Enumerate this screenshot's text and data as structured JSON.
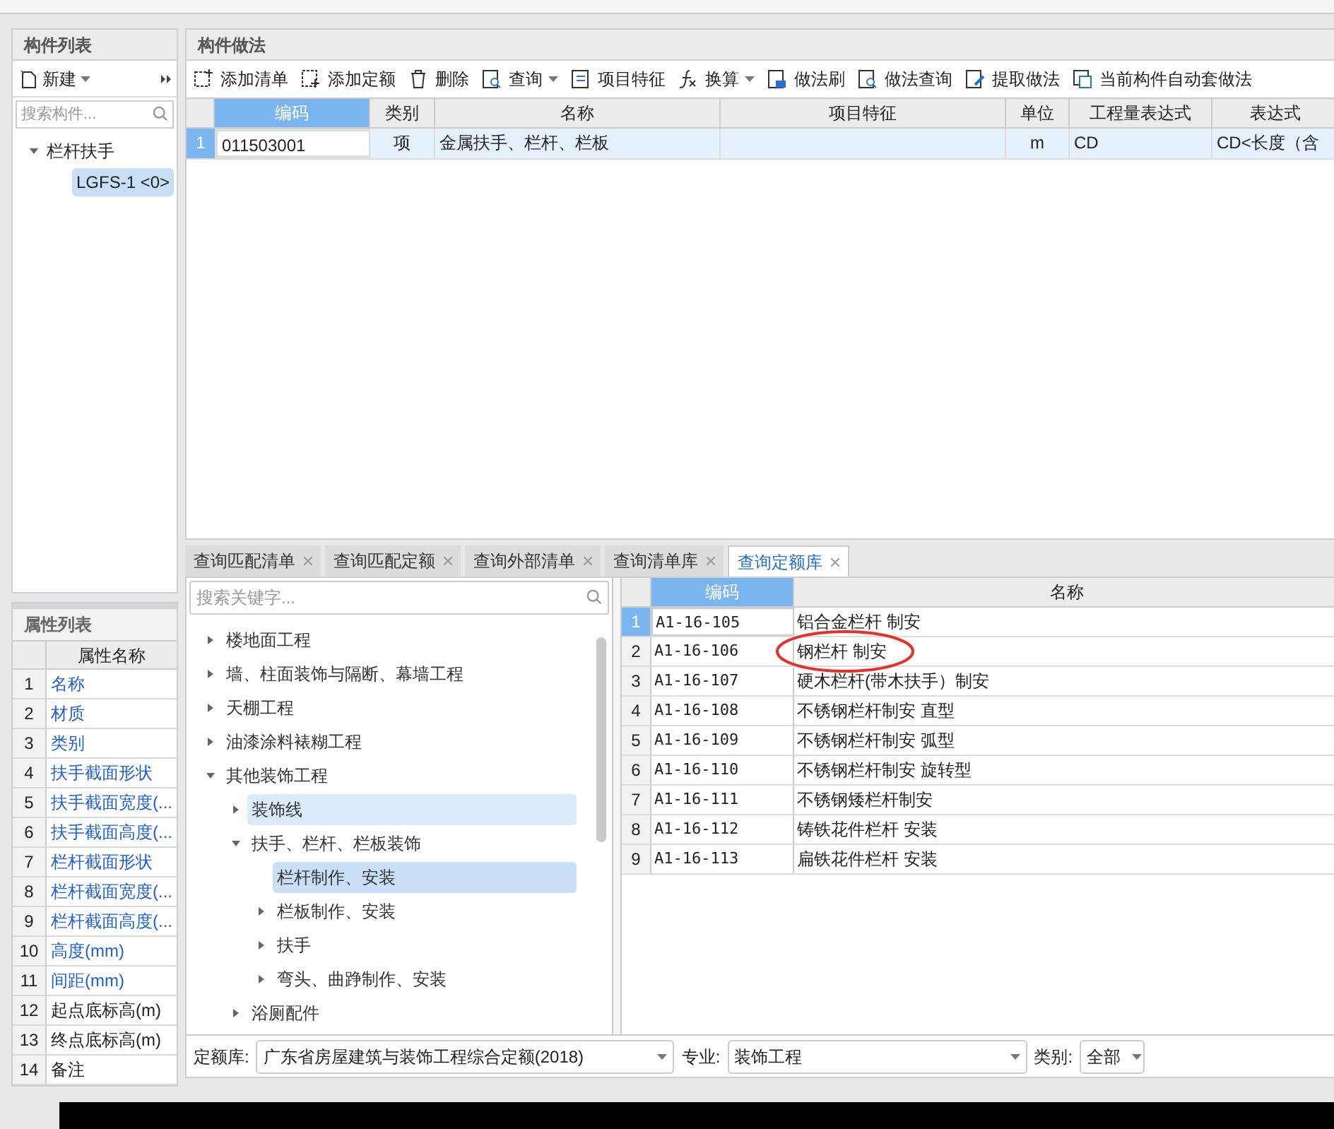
{
  "component_list": {
    "title": "构件列表",
    "new_button": "新建",
    "search": {
      "placeholder": "搜索构件..."
    },
    "tree": [
      {
        "label": "栏杆扶手",
        "expanded": true,
        "selected": false,
        "children": [
          {
            "label": "LGFS-1 <0>",
            "selected": true
          }
        ]
      }
    ]
  },
  "property_list": {
    "title": "属性列表",
    "column": "属性名称",
    "rows": [
      {
        "num": "1",
        "name": "名称",
        "blue": true
      },
      {
        "num": "2",
        "name": "材质",
        "blue": true
      },
      {
        "num": "3",
        "name": "类别",
        "blue": true
      },
      {
        "num": "4",
        "name": "扶手截面形状",
        "blue": true
      },
      {
        "num": "5",
        "name": "扶手截面宽度(...",
        "blue": true
      },
      {
        "num": "6",
        "name": "扶手截面高度(...",
        "blue": true
      },
      {
        "num": "7",
        "name": "栏杆截面形状",
        "blue": true
      },
      {
        "num": "8",
        "name": "栏杆截面宽度(...",
        "blue": true
      },
      {
        "num": "9",
        "name": "栏杆截面高度(...",
        "blue": true
      },
      {
        "num": "10",
        "name": "高度(mm)",
        "blue": true
      },
      {
        "num": "11",
        "name": "间距(mm)",
        "blue": true
      },
      {
        "num": "12",
        "name": "起点底标高(m)",
        "blue": false
      },
      {
        "num": "13",
        "name": "终点底标高(m)",
        "blue": false
      },
      {
        "num": "14",
        "name": "备注",
        "blue": false
      }
    ]
  },
  "method_panel": {
    "title": "构件做法",
    "toolbar": [
      {
        "label": "添加清单",
        "dropdown": false
      },
      {
        "label": "添加定额",
        "dropdown": false
      },
      {
        "label": "删除",
        "dropdown": false
      },
      {
        "label": "查询",
        "dropdown": true
      },
      {
        "label": "项目特征",
        "dropdown": false
      },
      {
        "label": "换算",
        "dropdown": true
      },
      {
        "label": "做法刷",
        "dropdown": false
      },
      {
        "label": "做法查询",
        "dropdown": false
      },
      {
        "label": "提取做法",
        "dropdown": false
      },
      {
        "label": "当前构件自动套做法",
        "dropdown": false
      }
    ],
    "table": {
      "columns": [
        "编码",
        "类别",
        "名称",
        "项目特征",
        "单位",
        "工程量表达式",
        "表达式"
      ],
      "rows": [
        {
          "num": "1",
          "selected": true,
          "cells": [
            "011503001",
            "项",
            "金属扶手、栏杆、栏板",
            "",
            "m",
            "CD",
            "CD<长度（含"
          ]
        }
      ]
    }
  },
  "query_tabs": [
    {
      "label": "查询匹配清单",
      "selected": false
    },
    {
      "label": "查询匹配定额",
      "selected": false
    },
    {
      "label": "查询外部清单",
      "selected": false
    },
    {
      "label": "查询清单库",
      "selected": false
    },
    {
      "label": "查询定额库",
      "selected": true
    }
  ],
  "quota_tree": {
    "search": {
      "placeholder": "搜索关键字..."
    },
    "items": [
      {
        "label": "楼地面工程",
        "expanded": false,
        "selected": false,
        "hover": false
      },
      {
        "label": "墙、柱面装饰与隔断、幕墙工程",
        "expanded": false,
        "selected": false,
        "hover": false
      },
      {
        "label": "天棚工程",
        "expanded": false,
        "selected": false,
        "hover": false
      },
      {
        "label": "油漆涂料裱糊工程",
        "expanded": false,
        "selected": false,
        "hover": false
      },
      {
        "label": "其他装饰工程",
        "expanded": true,
        "selected": false,
        "hover": false,
        "children": [
          {
            "label": "装饰线",
            "expanded": false,
            "selected": false,
            "hover": true
          },
          {
            "label": "扶手、栏杆、栏板装饰",
            "expanded": true,
            "selected": false,
            "hover": false,
            "children": [
              {
                "label": "栏杆制作、安装",
                "leaf": true,
                "selected": true
              },
              {
                "label": "栏板制作、安装",
                "expanded": false,
                "selected": false,
                "hover": false
              },
              {
                "label": "扶手",
                "expanded": false,
                "selected": false,
                "hover": false
              },
              {
                "label": "弯头、曲踭制作、安装",
                "expanded": false,
                "selected": false,
                "hover": false
              }
            ]
          },
          {
            "label": "浴厕配件",
            "expanded": false,
            "selected": false,
            "hover": false
          }
        ]
      }
    ]
  },
  "quota_table": {
    "columns": [
      "编码",
      "名称"
    ],
    "rows": [
      {
        "num": "1",
        "code": "A1-16-105",
        "name": "铝合金栏杆 制安",
        "selected": true,
        "circled": false
      },
      {
        "num": "2",
        "code": "A1-16-106",
        "name": "钢栏杆 制安",
        "selected": false,
        "circled": true
      },
      {
        "num": "3",
        "code": "A1-16-107",
        "name": "硬木栏杆(带木扶手）制安",
        "selected": false,
        "circled": false
      },
      {
        "num": "4",
        "code": "A1-16-108",
        "name": "不锈钢栏杆制安 直型",
        "selected": false,
        "circled": false
      },
      {
        "num": "5",
        "code": "A1-16-109",
        "name": "不锈钢栏杆制安 弧型",
        "selected": false,
        "circled": false
      },
      {
        "num": "6",
        "code": "A1-16-110",
        "name": "不锈钢栏杆制安 旋转型",
        "selected": false,
        "circled": false
      },
      {
        "num": "7",
        "code": "A1-16-111",
        "name": "不锈钢矮栏杆制安",
        "selected": false,
        "circled": false
      },
      {
        "num": "8",
        "code": "A1-16-112",
        "name": "铸铁花件栏杆 安装",
        "selected": false,
        "circled": false
      },
      {
        "num": "9",
        "code": "A1-16-113",
        "name": "扁铁花件栏杆 安装",
        "selected": false,
        "circled": false
      }
    ]
  },
  "filters": [
    {
      "label": "定额库:",
      "value": "广东省房屋建筑与装饰工程综合定额(2018)"
    },
    {
      "label": "专业:",
      "value": "装饰工程"
    },
    {
      "label": "类别:",
      "value": "全部"
    }
  ]
}
